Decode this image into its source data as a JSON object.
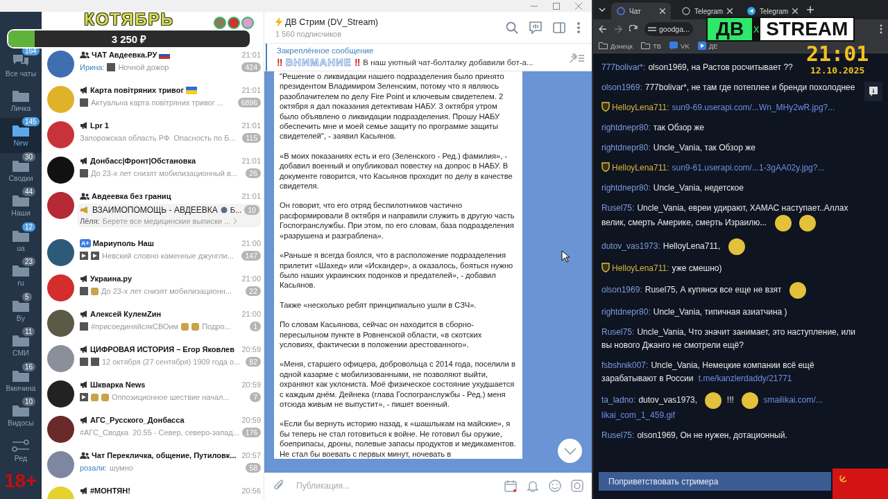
{
  "telegram": {
    "folders": [
      {
        "kind": "all",
        "label": "Все чаты",
        "count": "164",
        "muted": false,
        "selected": false
      },
      {
        "kind": "folder",
        "label": "Личка",
        "selected": false
      },
      {
        "kind": "folder",
        "label": "New",
        "count": "145",
        "muted": false,
        "selected": true
      },
      {
        "kind": "folder",
        "label": "Сводки",
        "count": "30",
        "muted": true,
        "selected": false
      },
      {
        "kind": "folder",
        "label": "Наши",
        "count": "44",
        "muted": true,
        "selected": false
      },
      {
        "kind": "folder",
        "label": "ua",
        "count": "12",
        "muted": false,
        "selected": false
      },
      {
        "kind": "folder",
        "label": "ru",
        "count": "23",
        "muted": true,
        "selected": false
      },
      {
        "kind": "folder",
        "label": "By",
        "count": "5",
        "muted": true,
        "selected": false
      },
      {
        "kind": "folder",
        "label": "СМИ",
        "count": "11",
        "muted": true,
        "selected": false
      },
      {
        "kind": "folder",
        "label": "Вмячина",
        "count": "16",
        "muted": true,
        "selected": false
      },
      {
        "kind": "folder",
        "label": "Видосы",
        "count": "10",
        "muted": true,
        "selected": false
      },
      {
        "kind": "edit",
        "label": "Ред",
        "selected": false
      }
    ],
    "chats": [
      {
        "kind": "group",
        "title": "ЧАТ Авдеевка.РУ",
        "flag": {
          "kind": "ru"
        },
        "time": "21:01",
        "sender": "Ирина:",
        "media": [
          {
            "kind": "photo"
          }
        ],
        "preview": "Ночной дожор",
        "count": "424",
        "muted": true
      },
      {
        "kind": "channel",
        "title": "Карта повітряних тривог",
        "flag": {
          "kind": "ua"
        },
        "time": "21:01",
        "media": [
          {
            "kind": "photo"
          }
        ],
        "preview": "Актуальна карта повітряних тривог ...",
        "count": "6896",
        "muted": true
      },
      {
        "kind": "channel",
        "title": "Lpr 1",
        "time": "21:01",
        "preview": "Запорожская область РФ  Опасность по Б...",
        "count": "115",
        "muted": true
      },
      {
        "kind": "channel",
        "title": "Донбасс|Фронт|Обстановка",
        "time": "21:01",
        "media": [
          {
            "kind": "photo"
          }
        ],
        "preview": "До 23-х лет снизят мобилизационный в...",
        "count": "26",
        "muted": true
      },
      {
        "kind": "group",
        "title": "Авдеевка без границ",
        "time": "21:01",
        "count": "10",
        "muted": true,
        "topic": {
          "title": "ВЗАИМОПОМОЩЬ - АВДЕЕВКА",
          "tail": "Б...",
          "sender": "Лёля:",
          "text": "Берете все медицинские выписки ..."
        }
      },
      {
        "kind": "boost",
        "type_label": "A+",
        "title": "Мариуполь Наш",
        "time": "21:00",
        "media": [
          {
            "kind": "video"
          },
          {
            "kind": "video"
          }
        ],
        "preview": "Невский словно каменные джунгли...",
        "count": "147",
        "muted": true
      },
      {
        "kind": "channel",
        "title": "Украина.ру",
        "time": "21:00",
        "media": [
          {
            "kind": "photo"
          },
          {
            "kind": "emoji"
          }
        ],
        "preview": "До 23-х лет снизят мобилизационн...",
        "count": "22",
        "muted": true
      },
      {
        "kind": "channel",
        "title": "Алексей КулемZин",
        "time": "21:00",
        "media": [
          {
            "kind": "photo"
          }
        ],
        "preview": "#присоединяйсякСВОим",
        "media_after": [
          {
            "kind": "emoji"
          },
          {
            "kind": "emoji"
          }
        ],
        "preview_tail": "Подро...",
        "count": "1",
        "muted": true
      },
      {
        "kind": "channel",
        "title": "ЦИФРОВАЯ ИСТОРИЯ – Егор Яковлев",
        "time": "20:59",
        "media": [
          {
            "kind": "photo"
          },
          {
            "kind": "photo"
          }
        ],
        "preview": "12 октября (27 сентября) 1909 года о...",
        "count": "82",
        "muted": true
      },
      {
        "kind": "channel",
        "title": "Шкварка News",
        "time": "20:59",
        "media": [
          {
            "kind": "video"
          },
          {
            "kind": "emoji"
          },
          {
            "kind": "emoji"
          }
        ],
        "preview": "Оппозиционное шествие начал...",
        "count": "7",
        "muted": true
      },
      {
        "kind": "channel",
        "title": "АГС_Русского_Донбасса",
        "time": "20:59",
        "preview": "#АГС_Сводка  20.55 - Север, северо-запад...",
        "count": "176",
        "muted": true
      },
      {
        "kind": "group",
        "title": "Чат Перекличка, общение, Путиловк...",
        "time": "20:57",
        "sender": "розали:",
        "preview": "шумно",
        "count": "58",
        "muted": true
      },
      {
        "kind": "channel",
        "title": "#МОНТЯН!",
        "time": "20:56"
      }
    ],
    "channel": {
      "title": "ДВ Стрим (DV_Stream)",
      "subtitle": "1 560 подписчиков"
    },
    "pinned": {
      "label": "Закреплённое сообщение",
      "marks": "‼",
      "emphasis": "ВНИМАНИЕ",
      "text": "В наш уютный чат-болталку добавили бот-а..."
    },
    "message": {
      "paragraphs": [
        "\"Решение о ликвидации нашего подразделения было принято президентом Владимиром Зеленским, потому что я являюсь разоблачителем по делу Fire Point и ключевым свидетелем. 2 октября я дал показания детективам НАБУ. 3 октября утром было объявлено о ликвидации подразделения. Прошу НАБУ обеспечить мне и моей семье защиту по программе защиты свидетелей\", - заявил Касьянов.",
        "«В моих показаниях есть и его (Зеленского - Ред.) фамилия», - добавил военный и опубликовал повестку на допрос в НАБУ. В документе говорится, что Касьянов проходит по делу в качестве свидетеля.",
        "Он говорит, что его отряд беспилотников частично расформировали 8 октября и направили служить в другую часть Госпогранслужбы. При этом, по его словам, база подразделения «разрушена и разграблена».",
        "«Раньше я всегда боялся, что в расположение подразделения прилетит «Шахед» или «Искандер», а оказалось, бояться нужно было наших украинских подонков и предателей», - добавил Касьянов.",
        "Также «несколько ребят принципиально ушли в СЗЧ».",
        "По словам Касьянова, сейчас он находится в сборно-пересыльном пункте в Ровненской области, «в скотских условиях, фактически в положении арестованного».",
        "«Меня, старшего офицера, добровольца с 2014 года, поселили в одной казарме с мобилизованными, не позволяют выйти, охраняют как уклониста. Моё физическое состояние ухудшается с каждым днём. Дейнека (глава Госпогранслужбы - Ред.) меня отсюда живым не выпустит», - пишет военный.",
        "«Если бы вернуть историю назад, к «шашлыкам на майские», я бы теперь не стал готовиться к войне. Не готовил бы оружие, боеприпасы, дроны, полевые запасы продуктов и медикаментов. Не стал бы воевать с первых минут, ночевать в"
      ]
    },
    "composer": {
      "placeholder": "Публикация..."
    }
  },
  "browser": {
    "tabs": [
      {
        "kind": "g",
        "title": "Чат",
        "selected": true
      },
      {
        "kind": "globe",
        "title": "Telegram",
        "selected": false
      },
      {
        "kind": "telegram",
        "title": "Telegram",
        "selected": false
      }
    ],
    "address": "goodga...",
    "bookmarks": [
      {
        "kind": "folder",
        "label": "Донецк"
      },
      {
        "kind": "folder",
        "label": "ТВ"
      },
      {
        "kind": "vk",
        "label": "VK"
      },
      {
        "kind": "play",
        "label": "ДЕ"
      }
    ],
    "chat": [
      {
        "user": "777bolivar*:",
        "vip": false,
        "parts": [
          {
            "kind": "text",
            "text": "olson1969, на Растов росчитывает ??"
          }
        ]
      },
      {
        "user": "olson1969:",
        "vip": false,
        "parts": [
          {
            "kind": "text",
            "text": "777bolivar*, не там где потеплее и бренди похолоднее"
          }
        ]
      },
      {
        "user": "HelloyLena711:",
        "vip": true,
        "parts": [
          {
            "kind": "link",
            "text": "sun9-69.userapi.com/...Wn_MHy2wR.jpg?..."
          }
        ]
      },
      {
        "user": "rightdnepr80:",
        "vip": false,
        "parts": [
          {
            "kind": "text",
            "text": "так Обзор же"
          }
        ]
      },
      {
        "user": "rightdnepr80:",
        "vip": false,
        "parts": [
          {
            "kind": "text",
            "text": "Uncle_Vania, так Обзор же"
          }
        ]
      },
      {
        "user": "HelloyLena711:",
        "vip": true,
        "parts": [
          {
            "kind": "link",
            "text": "sun9-61.userapi.com/...1-3gAA02y.jpg?..."
          }
        ]
      },
      {
        "user": "rightdnepr80:",
        "vip": false,
        "parts": [
          {
            "kind": "text",
            "text": "Uncle_Vania, недетское"
          }
        ]
      },
      {
        "user": "Rusel75:",
        "vip": false,
        "parts": [
          {
            "kind": "text",
            "text": "Uncle_Vania, евреи удирают, ХАМАС наступает..Аллах"
          },
          {
            "kind": "text",
            "text": "велик, смерть Америке, смерть Израилю..."
          },
          {
            "kind": "sticker"
          },
          {
            "kind": "sticker"
          }
        ]
      },
      {
        "user": "dutov_vas1973:",
        "vip": false,
        "parts": [
          {
            "kind": "text",
            "text": "HelloyLena711,"
          },
          {
            "kind": "sticker"
          }
        ]
      },
      {
        "user": "HelloyLena711:",
        "vip": true,
        "parts": [
          {
            "kind": "text",
            "text": "уже смешно)"
          }
        ]
      },
      {
        "user": "olson1969:",
        "vip": false,
        "parts": [
          {
            "kind": "text",
            "text": "Rusel75, А купянск все еще не взят"
          },
          {
            "kind": "sticker"
          }
        ]
      },
      {
        "user": "rightdnepr80:",
        "vip": false,
        "parts": [
          {
            "kind": "text",
            "text": "Uncle_Vania, типичная азиатчина )"
          }
        ]
      },
      {
        "user": "Rusel75:",
        "vip": false,
        "parts": [
          {
            "kind": "text",
            "text": "Uncle_Vania, Что значит занимает, это наступление, или"
          },
          {
            "kind": "text",
            "text": "вы нового Джанго не смотрели ещё?"
          }
        ]
      },
      {
        "user": "fsbshnik007:",
        "vip": false,
        "parts": [
          {
            "kind": "text",
            "text": "Uncle_Vania, Немецкие компании всё ещё"
          },
          {
            "kind": "text",
            "text": "зарабатывают в России"
          },
          {
            "kind": "link",
            "text": "t.me/kanzlerdaddy/21771"
          }
        ]
      },
      {
        "user": "ta_ladno:",
        "vip": false,
        "parts": [
          {
            "kind": "text",
            "text": "dutov_vas1973,"
          },
          {
            "kind": "sticker"
          },
          {
            "kind": "text",
            "text": "!!!"
          },
          {
            "kind": "sticker"
          },
          {
            "kind": "link",
            "text": "smailikai.com/..."
          },
          {
            "kind": "link",
            "text": "likai_com_1_459.gif"
          }
        ]
      },
      {
        "user": "Rusel75:",
        "vip": false,
        "parts": [
          {
            "kind": "text",
            "text": "olson1969, Он не нужен, дотационный."
          }
        ]
      }
    ],
    "greet_button": "Поприветствовать стримера"
  },
  "overlay": {
    "goal": {
      "title": "КОТЯБРЬ",
      "amount": "3 250 ₽",
      "level": 0.11
    },
    "age": "18+",
    "logo": {
      "left": "ДВ",
      "sep": "x",
      "right": "STREAM"
    },
    "clock": {
      "time": "21:01",
      "date": "12.10.2025"
    }
  }
}
